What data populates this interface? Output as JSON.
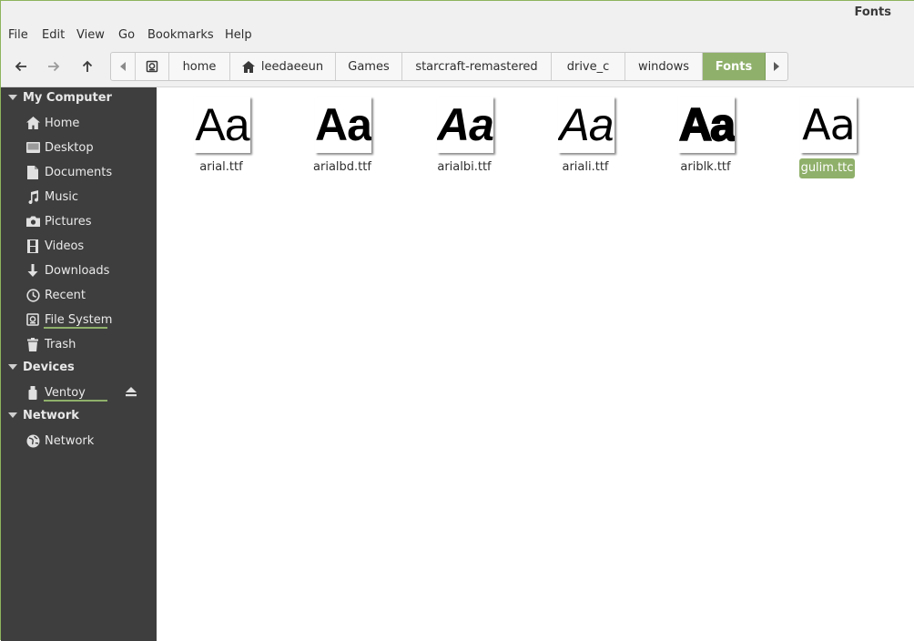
{
  "window": {
    "title": "Fonts"
  },
  "menu": [
    "File",
    "Edit",
    "View",
    "Go",
    "Bookmarks",
    "Help"
  ],
  "path": [
    "home",
    "leedaeeun",
    "Games",
    "starcraft-remastered",
    "drive_c",
    "windows",
    "Fonts"
  ],
  "sidebar": {
    "sections": [
      {
        "title": "My Computer",
        "items": [
          {
            "label": "Home",
            "icon": "home-icon"
          },
          {
            "label": "Desktop",
            "icon": "desktop-icon"
          },
          {
            "label": "Documents",
            "icon": "documents-icon"
          },
          {
            "label": "Music",
            "icon": "music-icon"
          },
          {
            "label": "Pictures",
            "icon": "pictures-icon"
          },
          {
            "label": "Videos",
            "icon": "videos-icon"
          },
          {
            "label": "Downloads",
            "icon": "downloads-icon"
          },
          {
            "label": "Recent",
            "icon": "recent-icon"
          },
          {
            "label": "File System",
            "icon": "filesystem-icon"
          },
          {
            "label": "Trash",
            "icon": "trash-icon"
          }
        ]
      },
      {
        "title": "Devices",
        "items": [
          {
            "label": "Ventoy",
            "icon": "usb-drive-icon"
          }
        ]
      },
      {
        "title": "Network",
        "items": [
          {
            "label": "Network",
            "icon": "network-icon"
          }
        ]
      }
    ]
  },
  "files": [
    {
      "name": "arial.ttf",
      "preview": "Aa",
      "style": "regular"
    },
    {
      "name": "arialbd.ttf",
      "preview": "Aa",
      "style": "bold"
    },
    {
      "name": "arialbi.ttf",
      "preview": "Aa",
      "style": "bold-italic"
    },
    {
      "name": "ariali.ttf",
      "preview": "Aa",
      "style": "italic"
    },
    {
      "name": "ariblk.ttf",
      "preview": "Aa",
      "style": "black"
    },
    {
      "name": "gulim.ttc",
      "preview": "Aa",
      "style": "light",
      "selected": true
    }
  ],
  "colors": {
    "accent": "#8fb06a",
    "sidebar_bg": "#3e3e3e",
    "toolbar_bg": "#f0f0f0"
  }
}
